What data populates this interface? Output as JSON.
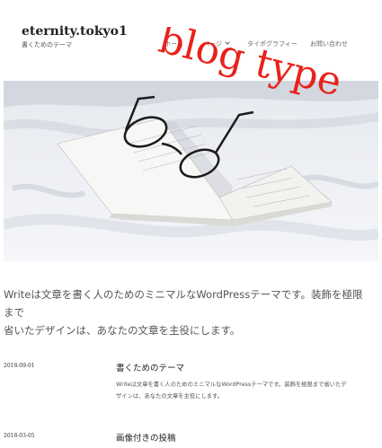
{
  "site": {
    "title": "eternity.tokyo1",
    "description": "書くためのテーマ"
  },
  "nav": {
    "items": [
      {
        "label": "ホーム"
      },
      {
        "label": "ページ"
      },
      {
        "label": "タイポグラフィー"
      },
      {
        "label": "お問い合わせ"
      }
    ]
  },
  "overlay": {
    "text": "blog type",
    "color": "#e8221b"
  },
  "intro": {
    "line1": "Writeは文章を書く人のためのミニマルなWordPressテーマです。装飾を極限まで",
    "line2": "省いたデザインは、あなたの文章を主役にします。"
  },
  "posts": [
    {
      "date": "2018-09-01",
      "title": "書くためのテーマ",
      "excerpt_line1": "Writeは文章を書く人のためのミニマルなWordPressテーマです。装飾を極限まで省いたデ",
      "excerpt_line2": "ザインは、あなたの文章を主役にします。"
    },
    {
      "date": "2018-03-05",
      "title": "画像付きの投稿"
    }
  ]
}
